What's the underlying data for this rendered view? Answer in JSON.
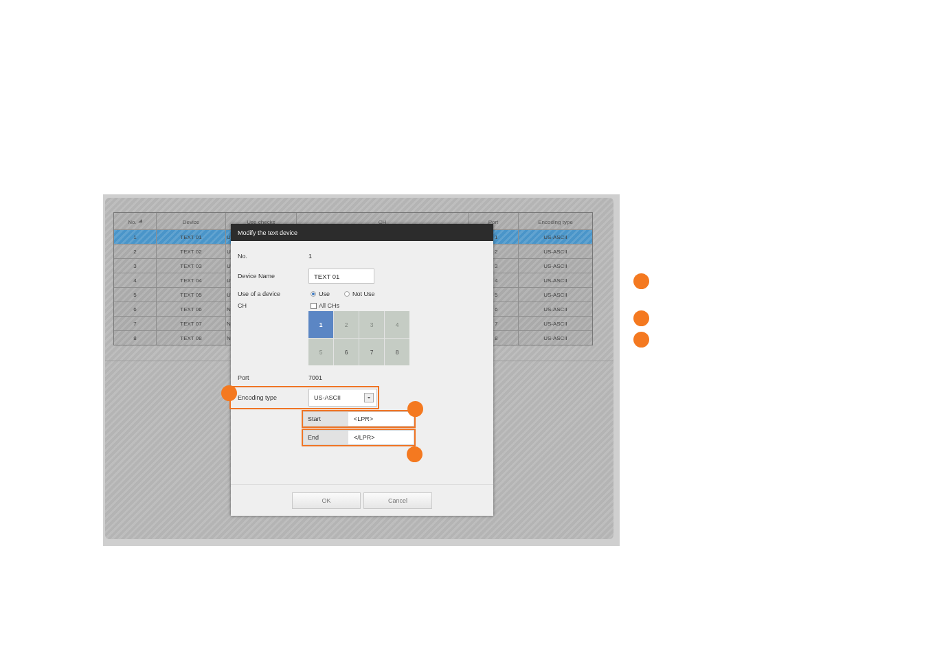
{
  "table": {
    "columns": [
      {
        "label": "No.",
        "sorted": true
      },
      {
        "label": "Device",
        "sorted": false
      },
      {
        "label": "Use checks",
        "sorted": false
      },
      {
        "label": "CH",
        "sorted": false
      },
      {
        "label": "Port",
        "sorted": false
      },
      {
        "label": "Encoding type",
        "sorted": false
      }
    ],
    "rows": [
      {
        "no": "1",
        "device": "TEXT 01",
        "use": "U",
        "port": "1",
        "encoding": "US-ASCII",
        "selected": true
      },
      {
        "no": "2",
        "device": "TEXT 02",
        "use": "U",
        "port": "2",
        "encoding": "US-ASCII",
        "selected": false
      },
      {
        "no": "3",
        "device": "TEXT 03",
        "use": "U",
        "port": "3",
        "encoding": "US-ASCII",
        "selected": false
      },
      {
        "no": "4",
        "device": "TEXT 04",
        "use": "U",
        "port": "4",
        "encoding": "US-ASCII",
        "selected": false
      },
      {
        "no": "5",
        "device": "TEXT 05",
        "use": "U",
        "port": "5",
        "encoding": "US-ASCII",
        "selected": false
      },
      {
        "no": "6",
        "device": "TEXT 06",
        "use": "N",
        "port": "6",
        "encoding": "US-ASCII",
        "selected": false
      },
      {
        "no": "7",
        "device": "TEXT 07",
        "use": "N",
        "port": "7",
        "encoding": "US-ASCII",
        "selected": false
      },
      {
        "no": "8",
        "device": "TEXT 08",
        "use": "N",
        "port": "8",
        "encoding": "US-ASCII",
        "selected": false
      }
    ]
  },
  "dialog": {
    "title": "Modify the text device",
    "fields": [
      {
        "kind": "text",
        "label": "No.",
        "value": "1"
      },
      {
        "kind": "input",
        "label": "Device Name",
        "value": "TEXT 01"
      },
      {
        "kind": "radio",
        "label": "Use of a device",
        "options": [
          {
            "label": "Use",
            "selected": true
          },
          {
            "label": "Not Use",
            "selected": false
          }
        ]
      },
      {
        "kind": "channels",
        "label": "CH",
        "all_label": "All CHs",
        "all_checked": false,
        "channels": [
          {
            "label": "1",
            "selected": true,
            "disabled": false
          },
          {
            "label": "2",
            "selected": false,
            "disabled": true
          },
          {
            "label": "3",
            "selected": false,
            "disabled": true
          },
          {
            "label": "4",
            "selected": false,
            "disabled": true
          },
          {
            "label": "5",
            "selected": false,
            "disabled": true
          },
          {
            "label": "6",
            "selected": false,
            "disabled": false
          },
          {
            "label": "7",
            "selected": false,
            "disabled": false
          },
          {
            "label": "8",
            "selected": false,
            "disabled": false
          }
        ]
      },
      {
        "kind": "text",
        "label": "Port",
        "value": "7001"
      },
      {
        "kind": "select",
        "label": "Encoding type",
        "value": "US-ASCII",
        "highlighted": true
      }
    ],
    "markers": [
      {
        "label": "Start",
        "value": "<LPR>",
        "highlighted": true
      },
      {
        "label": "End",
        "value": "</LPR>",
        "highlighted": true
      }
    ],
    "buttons": [
      "OK",
      "Cancel"
    ]
  }
}
